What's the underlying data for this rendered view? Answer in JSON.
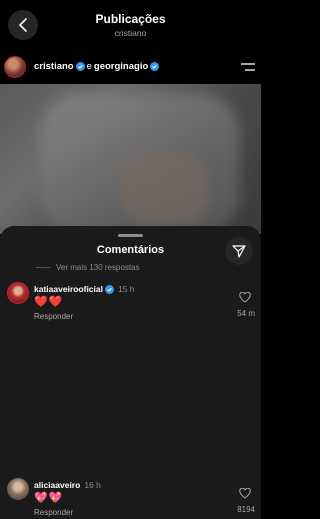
{
  "header": {
    "title": "Publicações",
    "subtitle": "cristiano",
    "back_icon": "chevron-left-icon"
  },
  "post": {
    "author": "cristiano",
    "connector": "e",
    "coauthor": "georginagio",
    "menu_icon": "menu-lines-icon"
  },
  "comments_sheet": {
    "title": "Comentários",
    "more_replies": "Ver mais 130 respostas",
    "share_icon": "paper-plane-icon",
    "comments": [
      {
        "username": "katiaaveirooficial",
        "time": "15 h",
        "text": "❤️❤️",
        "reply_label": "Responder",
        "likes": "54 m"
      },
      {
        "username": "aliciaaveiro",
        "time": "16 h",
        "text": "💖💖",
        "reply_label": "Responder",
        "likes": "8194"
      }
    ]
  },
  "colors": {
    "background": "#000000",
    "sheet": "#1a1a1a",
    "verified": "#3897f0",
    "secondary_text": "#a8a8a8"
  }
}
